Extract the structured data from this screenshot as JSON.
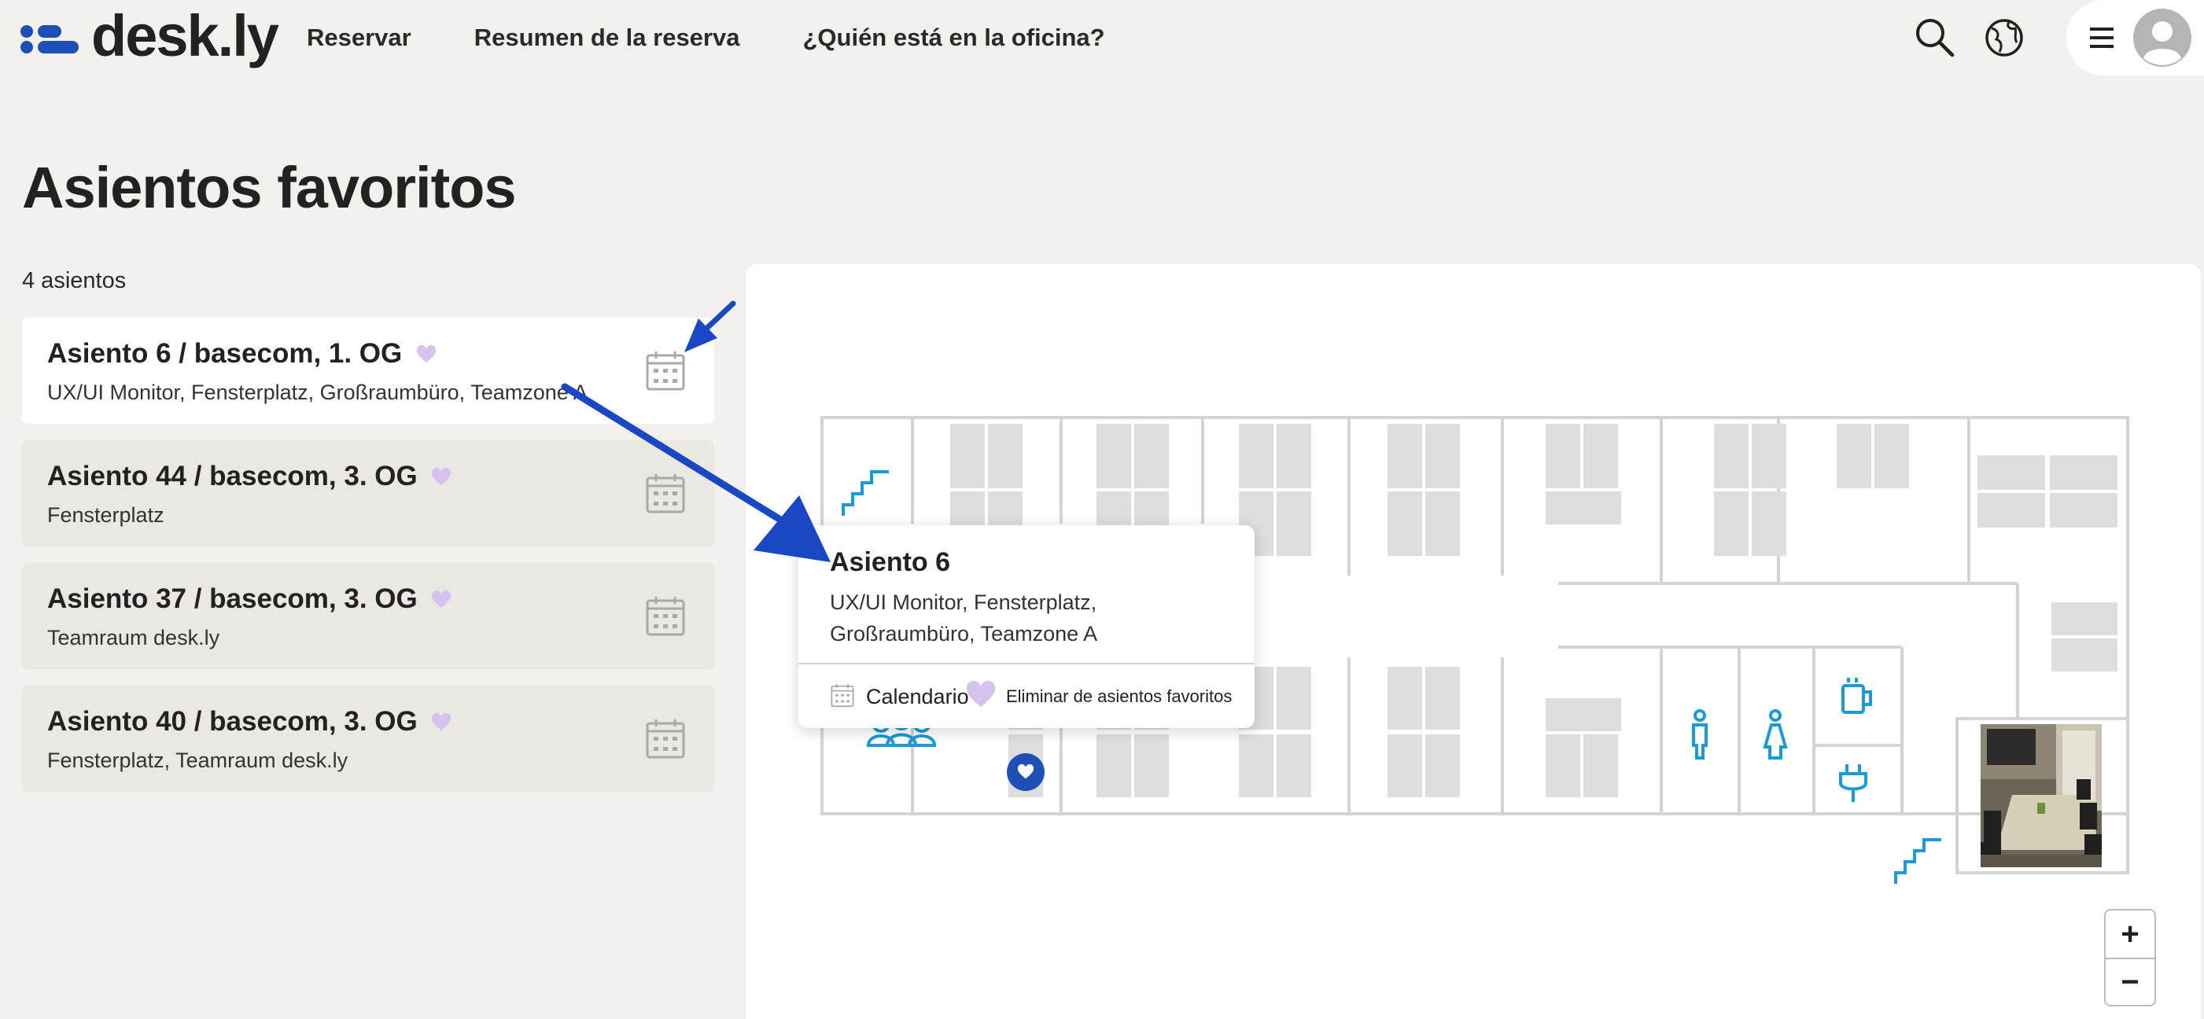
{
  "brand": {
    "name": "desk.ly",
    "accent": "#1d4fb6"
  },
  "nav": {
    "items": [
      {
        "label": "Reservar"
      },
      {
        "label": "Resumen de la reserva"
      },
      {
        "label": "¿Quién está en la oficina?"
      }
    ]
  },
  "header_icons": [
    "search-icon",
    "globe-icon",
    "hamburger-menu-icon",
    "user-avatar-icon"
  ],
  "page": {
    "title": "Asientos favoritos",
    "count": "4 asientos"
  },
  "seats": [
    {
      "title": "Asiento 6 / basecom, 1. OG",
      "desc": "UX/UI Monitor, Fensterplatz, Großraumbüro, Teamzone A",
      "selected": true
    },
    {
      "title": "Asiento 44 / basecom, 3. OG",
      "desc": "Fensterplatz"
    },
    {
      "title": "Asiento 37 / basecom, 3. OG",
      "desc": "Teamraum desk.ly"
    },
    {
      "title": "Asiento 40 / basecom, 3. OG",
      "desc": "Fensterplatz, Teamraum desk.ly"
    }
  ],
  "popup": {
    "title": "Asiento 6",
    "desc": "UX/UI Monitor, Fensterplatz, Großraumbüro, Teamzone A",
    "calendar_label": "Calendario",
    "remove_fav_label": "Eliminar de asientos favoritos"
  },
  "map": {
    "zoom_in": "+",
    "zoom_out": "−",
    "icons": [
      "stairs-icon",
      "meeting-group-icon",
      "male-restroom-icon",
      "female-restroom-icon",
      "coffee-icon",
      "power-plug-icon",
      "favorite-seat-pin"
    ]
  },
  "colors": {
    "background": "#f3f1ee",
    "card": "#ebe7e2",
    "map_lines": "#d4d4d4",
    "map_desks": "#dedede",
    "map_icons": "#1a9ad6",
    "favorite_heart": "#d6c2ef",
    "annotation_arrow": "#1a48c4"
  }
}
